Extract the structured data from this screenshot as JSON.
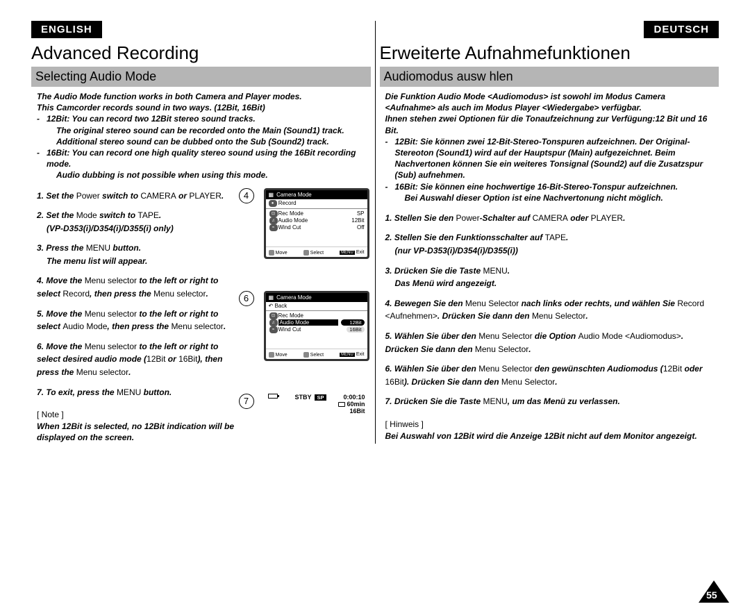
{
  "left": {
    "lang": "ENGLISH",
    "title": "Advanced Recording",
    "section": "Selecting Audio Mode",
    "intro": {
      "l1": "The Audio Mode function works in both Camera and Player modes.",
      "l2": "This Camcorder records sound in two ways. (12Bit, 16Bit)",
      "b1a": "12Bit: You can record two 12Bit stereo sound tracks.",
      "b1b": "The original stereo sound can be recorded onto the Main (Sound1) track.",
      "b1c": "Additional stereo sound can be dubbed onto the Sub (Sound2) track.",
      "b2a": "16Bit: You can record one high quality stereo sound using the 16Bit recording mode.",
      "b2b": "Audio dubbing is not possible when using this mode."
    },
    "steps": {
      "s1a": "Set the ",
      "s1b": "Power",
      "s1c": " switch to ",
      "s1d": "CAMERA",
      "s1e": " or ",
      "s1f": "PLAYER",
      "s1g": ".",
      "s2a": "Set the ",
      "s2b": "Mode",
      "s2c": " switch to ",
      "s2d": "TAPE",
      "s2e": ".",
      "s2sub": "(VP-D353(i)/D354(i)/D355(i) only)",
      "s3a": "Press the ",
      "s3b": "MENU",
      "s3c": " button.",
      "s3sub": "The menu list will appear.",
      "s4a": "Move the ",
      "s4b": "Menu selector",
      "s4c": " to the left or right to select ",
      "s4d": "Record",
      "s4e": ", then press the ",
      "s4f": "Menu selector",
      "s4g": ".",
      "s5a": "Move the ",
      "s5b": "Menu selector",
      "s5c": " to the left or right to select ",
      "s5d": "Audio Mode",
      "s5e": ", then press the ",
      "s5f": "Menu selector",
      "s5g": ".",
      "s6a": "Move the ",
      "s6b": "Menu selector",
      "s6c": " to the left or right to select desired audio mode (",
      "s6d": "12Bit",
      "s6e": " or ",
      "s6f": "16Bit",
      "s6g": "), then press the ",
      "s6h": "Menu selector",
      "s6i": ".",
      "s7a": "To exit, press the ",
      "s7b": "MENU",
      "s7c": " button."
    },
    "noteLabel": "[ Note ]",
    "noteBody": "When 12Bit is selected, no 12Bit indication will be displayed on the screen."
  },
  "right": {
    "lang": "DEUTSCH",
    "title": "Erweiterte Aufnahmefunktionen",
    "section": "Audiomodus ausw hlen",
    "intro": {
      "l1": "Die Funktion Audio Mode <Audiomodus> ist sowohl im Modus Camera <Aufnahme> als auch im Modus Player <Wiedergabe> verfügbar.",
      "l2": "Ihnen stehen zwei Optionen für die Tonaufzeichnung zur Verfügung:12 Bit und 16 Bit.",
      "b1a": "12Bit: Sie können zwei 12-Bit-Stereo-Tonspuren aufzeichnen. Der Original-Stereoton (Sound1) wird auf der Hauptspur (Main) aufgezeichnet. Beim Nachvertonen können Sie ein weiteres Tonsignal (Sound2) auf die Zusatzspur (Sub) aufnehmen.",
      "b2a": "16Bit: Sie können eine hochwertige 16-Bit-Stereo-Tonspur aufzeichnen.",
      "b2b": "Bei Auswahl dieser Option ist eine Nachvertonung nicht möglich."
    },
    "steps": {
      "s1a": "Stellen Sie den ",
      "s1b": "Power",
      "s1c": "-Schalter auf ",
      "s1d": "CAMERA",
      "s1e": " oder ",
      "s1f": "PLAYER",
      "s1g": ".",
      "s2a": "Stellen Sie den Funktionsschalter auf ",
      "s2b": "TAPE",
      "s2c": ".",
      "s2sub": "(nur VP-D353(i)/D354(i)/D355(i))",
      "s3a": "Drücken Sie die Taste ",
      "s3b": "MENU",
      "s3c": ".",
      "s3sub": "Das Menü wird angezeigt.",
      "s4a": "Bewegen Sie den ",
      "s4b": "Menu Selector",
      "s4c": " nach links oder rechts, und wählen Sie ",
      "s4d": "Record <Aufnehmen>",
      "s4e": ". Drücken Sie dann den ",
      "s4f": "Menu Selector",
      "s4g": ".",
      "s5a": "Wählen Sie über den ",
      "s5b": "Menu Selector",
      "s5c": " die Option ",
      "s5d": "Audio Mode <Audiomodus>",
      "s5e": ". Drücken Sie dann den ",
      "s5f": "Menu Selector",
      "s5g": ".",
      "s6a": "Wählen Sie über den ",
      "s6b": "Menu Selector",
      "s6c": " den gewünschten Audiomodus (",
      "s6d": "12Bit",
      "s6e": " oder ",
      "s6f": "16Bit",
      "s6g": "). Drücken Sie dann den ",
      "s6h": "Menu Selector",
      "s6i": ".",
      "s7a": "Drücken Sie die Taste ",
      "s7b": "MENU",
      "s7c": ", um das Menü zu verlassen."
    },
    "noteLabel": "[ Hinweis ]",
    "noteBody": "Bei Auswahl von 12Bit wird die Anzeige 12Bit nicht auf dem Monitor angezeigt."
  },
  "figs": {
    "n4": "4",
    "n6": "6",
    "n7": "7",
    "camMode": "Camera Mode",
    "record": "Record",
    "back": "Back",
    "recMode": "Rec Mode",
    "audioMode": "Audio Mode",
    "windCut": "Wind Cut",
    "sp": "SP",
    "v12": "12Bit",
    "v16": "16Bit",
    "off": "Off",
    "move": "Move",
    "select": "Select",
    "menu": "MENU",
    "exit": "Exit",
    "stby": "STBY",
    "time": "0:00:10",
    "remain": "60min"
  },
  "pageNum": "55"
}
